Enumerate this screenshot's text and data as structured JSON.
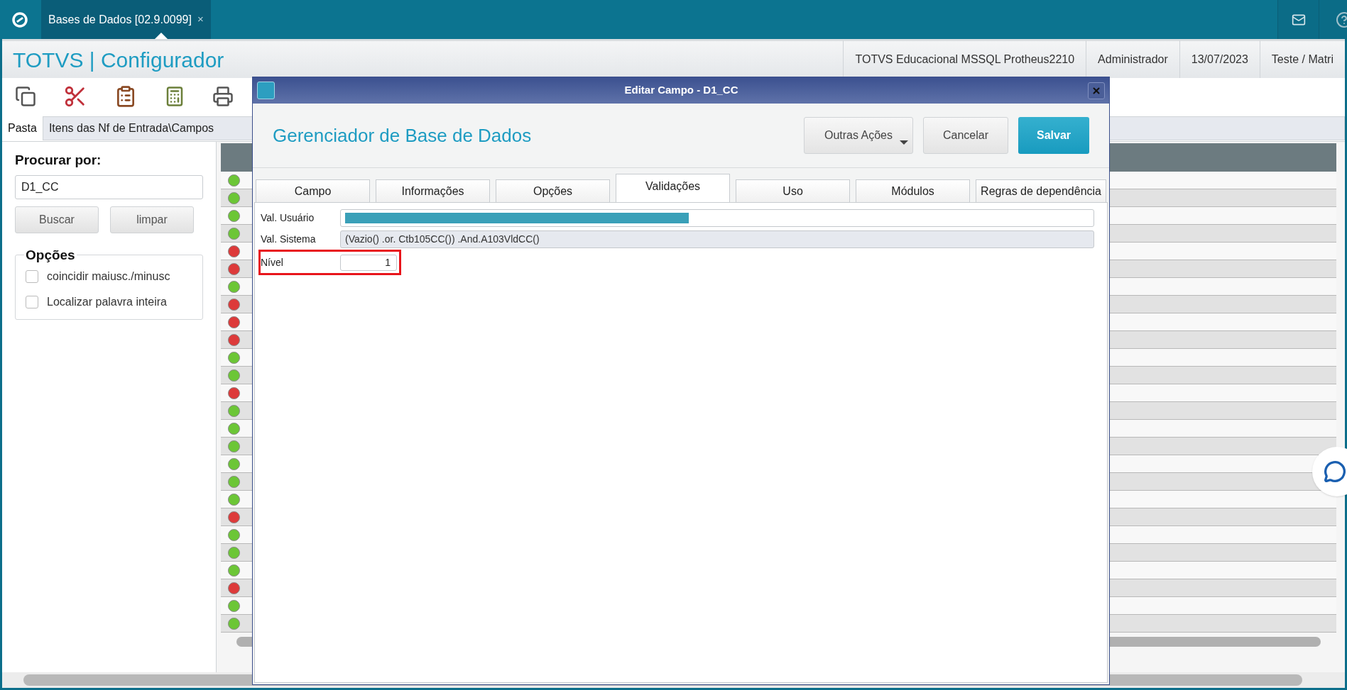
{
  "top_bar": {
    "tab": {
      "title": "Bases de Dados [02.9.0099]",
      "close": "×",
      "selected": true
    }
  },
  "header": {
    "title": "TOTVS | Configurador",
    "info": [
      "TOTVS Educacional MSSQL Protheus2210",
      "Administrador",
      "13/07/2023",
      "Teste / Matri"
    ]
  },
  "folder": {
    "label": "Pasta",
    "path": "Itens das Nf de Entrada\\Campos"
  },
  "search": {
    "label": "Procurar por:",
    "value": "D1_CC",
    "buttons": [
      "Buscar",
      "limpar"
    ]
  },
  "options": {
    "title": "Opções",
    "items": [
      {
        "label": "coincidir maiusc./minusc",
        "checked": false
      },
      {
        "label": "Localizar palavra inteira",
        "checked": false
      }
    ]
  },
  "grid": {
    "rows": [
      {
        "color": "#6cc636"
      },
      {
        "color": "#6cc636"
      },
      {
        "color": "#6cc636"
      },
      {
        "color": "#6cc636"
      },
      {
        "color": "#dd3a3a"
      },
      {
        "color": "#dd3a3a"
      },
      {
        "color": "#6cc636"
      },
      {
        "color": "#dd3a3a"
      },
      {
        "color": "#dd3a3a"
      },
      {
        "color": "#dd3a3a"
      },
      {
        "color": "#6cc636"
      },
      {
        "color": "#6cc636"
      },
      {
        "color": "#dd3a3a"
      },
      {
        "color": "#6cc636"
      },
      {
        "color": "#6cc636"
      },
      {
        "color": "#6cc636"
      },
      {
        "color": "#6cc636"
      },
      {
        "color": "#6cc636"
      },
      {
        "color": "#6cc636"
      },
      {
        "color": "#dd3a3a"
      },
      {
        "color": "#6cc636"
      },
      {
        "color": "#6cc636"
      },
      {
        "color": "#6cc636"
      },
      {
        "color": "#dd3a3a"
      },
      {
        "color": "#6cc636"
      },
      {
        "color": "#6cc636"
      }
    ]
  },
  "dialog": {
    "title": "Editar Campo - D1_CC",
    "heading": "Gerenciador de Base de Dados",
    "buttons": [
      {
        "label": "Outras Ações",
        "kind": "dropdown"
      },
      {
        "label": "Cancelar",
        "kind": "secondary"
      },
      {
        "label": "Salvar",
        "kind": "primary"
      }
    ],
    "tabs": [
      {
        "label": "Campo",
        "selected": false
      },
      {
        "label": "Informações",
        "selected": false
      },
      {
        "label": "Opções",
        "selected": false
      },
      {
        "label": "Validações",
        "selected": true
      },
      {
        "label": "Uso",
        "selected": false
      },
      {
        "label": "Módulos",
        "selected": false
      },
      {
        "label": "Regras de dependência",
        "selected": false
      }
    ],
    "fields": [
      {
        "label": "Val. Usuário",
        "kind": "selection",
        "disabled": false,
        "highlighted": false
      },
      {
        "label": "Val. Sistema",
        "kind": "text",
        "value": "(Vazio() .or. Ctb105CC()) .And.A103VldCC()",
        "disabled": true,
        "highlighted": false
      },
      {
        "label": "Nível",
        "kind": "number",
        "value": "1",
        "disabled": false,
        "highlighted": true
      }
    ]
  }
}
